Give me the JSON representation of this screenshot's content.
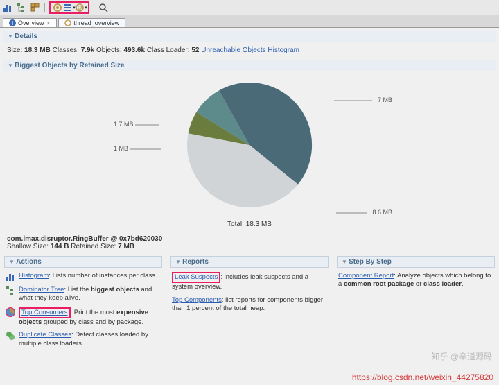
{
  "toolbar": {
    "icons": [
      "bar-chart-icon",
      "tree-icon",
      "squares-icon",
      "sep",
      "gear-icon",
      "list-icon",
      "spiral-icon",
      "sep",
      "search-icon"
    ]
  },
  "tabs": [
    {
      "icon": "info-icon",
      "label": "Overview",
      "active": true
    },
    {
      "icon": "gear-icon",
      "label": "thread_overview",
      "active": false
    }
  ],
  "details": {
    "title": "Details",
    "size_label": "Size:",
    "size_val": "18.3 MB",
    "classes_label": "Classes:",
    "classes_val": "7.9k",
    "objects_label": "Objects:",
    "objects_val": "493.6k",
    "cl_label": "Class Loader:",
    "cl_val": "52",
    "link": "Unreachable Objects Histogram"
  },
  "biggest": {
    "title": "Biggest Objects by Retained Size"
  },
  "chart_data": {
    "type": "pie",
    "series": [
      {
        "name": "7 MB",
        "value": 7.0,
        "color": "#4a6a78"
      },
      {
        "name": "1.7 MB",
        "value": 1.7,
        "color": "#5d8a8a"
      },
      {
        "name": "1 MB",
        "value": 1.0,
        "color": "#6a7d3e"
      },
      {
        "name": "8.6 MB",
        "value": 8.6,
        "color": "#d0d4d6"
      }
    ],
    "total_label": "Total: 18.3 MB",
    "labels": {
      "l7": "7 MB",
      "l17": "1.7 MB",
      "l1": "1 MB",
      "l86": "8.6 MB"
    }
  },
  "selected": {
    "name": "com.lmax.disruptor.RingBuffer @ 0x7bd620030",
    "shallow_label": "Shallow Size:",
    "shallow_val": "144 B",
    "retained_label": "Retained Size:",
    "retained_val": "7 MB"
  },
  "actions": {
    "title": "Actions",
    "items": [
      {
        "icon": "bar-chart-icon",
        "link": "Histogram",
        "text": ": Lists number of instances per class"
      },
      {
        "icon": "tree-icon",
        "link": "Dominator Tree",
        "text": ": List the ",
        "bold": "biggest objects",
        "text2": " and what they keep alive."
      },
      {
        "icon": "pie-icon",
        "link": "Top Consumers",
        "text": ": Print the most ",
        "bold": "expensive objects",
        "text2": " grouped by class and by package."
      },
      {
        "icon": "dup-icon",
        "link": "Duplicate Classes",
        "text": ": Detect classes loaded by multiple class loaders."
      }
    ]
  },
  "reports": {
    "title": "Reports",
    "items": [
      {
        "link": "Leak Suspects",
        "text": ": includes leak suspects and a system overview."
      },
      {
        "link": "Top Components",
        "text": ": list reports for components bigger than 1 percent of the total heap."
      }
    ]
  },
  "stepbystep": {
    "title": "Step By Step",
    "items": [
      {
        "link": "Component Report",
        "text": ": Analyze objects which belong to a ",
        "bold": "common root package",
        "text2": " or ",
        "bold2": "class loader",
        "text3": "."
      }
    ]
  },
  "watermark": "知乎 @辛道源码",
  "url": "https://blog.csdn.net/weixin_44275820"
}
